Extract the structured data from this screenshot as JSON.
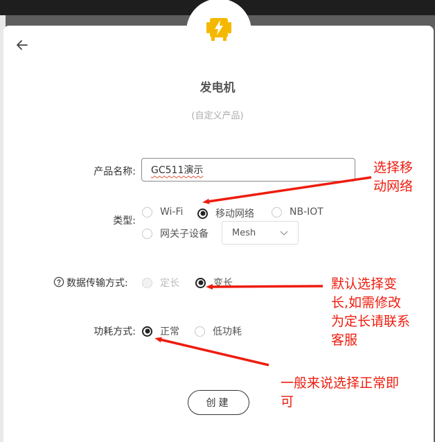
{
  "product": {
    "name": "发电机",
    "subtitle": "(自定义产品)"
  },
  "form": {
    "name_label": "产品名称:",
    "name_value": "GC511演示",
    "type_label": "类型:",
    "type_options": [
      "Wi-Fi",
      "移动网络",
      "NB-IOT",
      "网关子设备"
    ],
    "type_selected": "移动网络",
    "mesh_select": {
      "value": "Mesh",
      "options": [
        "Mesh"
      ]
    },
    "transfer_label": "数据传输方式:",
    "transfer_options": [
      "定长",
      "变长"
    ],
    "transfer_selected": "变长",
    "power_label": "功耗方式:",
    "power_options": [
      "正常",
      "低功耗"
    ],
    "power_selected": "正常",
    "create_button": "创建"
  },
  "annotations": {
    "a1_line1": "选择移",
    "a1_line2": "动网络",
    "a2_line1": "默认选择变",
    "a2_line2": "长,如需修改",
    "a2_line3": "为定长请联系",
    "a2_line4": "客服",
    "a3_line1": "一般来说选择正常即",
    "a3_line2": "可"
  },
  "colors": {
    "accent": "#f5b800",
    "annotation": "#ee1c0e",
    "radio_selected": "#222222"
  },
  "icons": [
    "back-arrow-icon",
    "generator-icon",
    "help-circle-icon",
    "chevron-down-icon"
  ]
}
